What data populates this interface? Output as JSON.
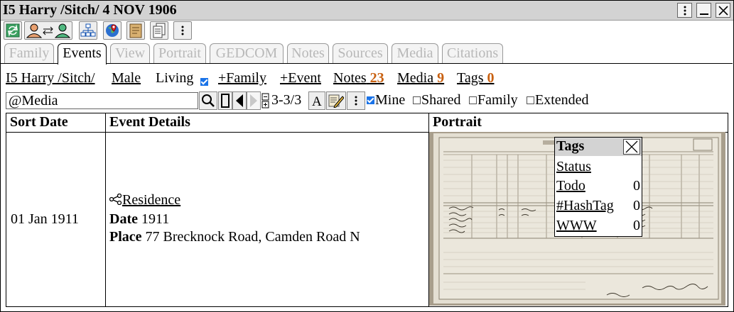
{
  "window": {
    "title": "I5 Harry /Sitch/ 4 NOV 1906"
  },
  "toolbar": {
    "icons": [
      "refresh-icon",
      "switch-person-icon",
      "tree-icon",
      "map-icon",
      "notes-icon",
      "documents-icon",
      "more-icon"
    ]
  },
  "tabs": [
    "Family",
    "Events",
    "View",
    "Portrait",
    "GEDCOM",
    "Notes",
    "Sources",
    "Media",
    "Citations"
  ],
  "active_tab": "Events",
  "person": {
    "name": "I5 Harry /Sitch/",
    "gender": "Male",
    "living_label": "Living",
    "add_family": "+Family",
    "add_event": "+Event",
    "notes_label": "Notes",
    "notes_count": "23",
    "media_label": "Media",
    "media_count": "9",
    "tags_label": "Tags",
    "tags_count": "0"
  },
  "filter": {
    "search_value": "@Media",
    "range": "3-3/3",
    "mine_label": "Mine",
    "shared_label": "Shared",
    "family_label": "Family",
    "extended_label": "Extended",
    "mine_checked": true,
    "shared_checked": false,
    "family_checked": false,
    "extended_checked": false
  },
  "table": {
    "headers": [
      "Sort Date",
      "Event Details",
      "Portrait"
    ],
    "rows": [
      {
        "sort_date": "01 Jan 1911",
        "event_type": "Residence",
        "date_label": "Date",
        "date_value": "1911",
        "place_label": "Place",
        "place_value": "77 Brecknock Road, Camden Road N"
      }
    ]
  },
  "tags_popup": {
    "title": "Tags",
    "items": [
      {
        "label": "Status",
        "count": ""
      },
      {
        "label": "Todo",
        "count": "0"
      },
      {
        "label": "#HashTag",
        "count": "0"
      },
      {
        "label": "WWW",
        "count": "0"
      }
    ]
  },
  "colors": {
    "count_orange": "#c86010",
    "titlebar_gray": "#d3d3d3",
    "checkbox_blue": "#1a73e8"
  }
}
